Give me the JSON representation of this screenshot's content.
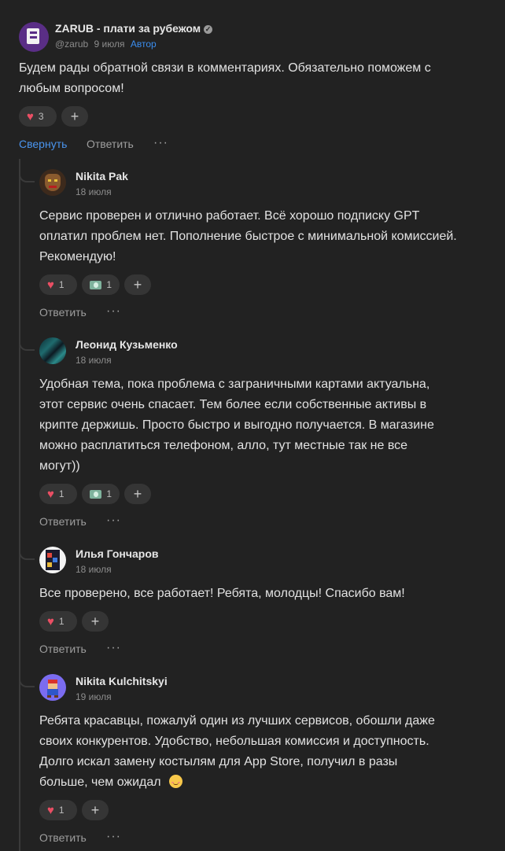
{
  "main_post": {
    "author": "ZARUB - плати за рубежом",
    "handle": "@zarub",
    "date": "9 июля",
    "tag": "Автор",
    "text": "Будем рады обратной связи в комментариях. Обязательно поможем с любым вопросом!",
    "likes": "3",
    "collapse_label": "Свернуть",
    "reply_label": "Ответить",
    "more_label": "···"
  },
  "comments": [
    {
      "author": "Nikita Pak",
      "date": "18 июля",
      "text": "Сервис проверен и отлично работает. Всё хорошо подписку GPT оплатил проблем нет. Пополнение быстрое с минимальной комиссией. Рекомендую!",
      "likes": "1",
      "money": "1",
      "reply_label": "Ответить",
      "more_label": "···"
    },
    {
      "author": "Леонид Кузьменко",
      "date": "18 июля",
      "text": "Удобная тема, пока проблема с заграничными картами актуальна, этот сервис очень спасает. Тем более если собственные активы в крипте держишь. Просто быстро и выгодно получается. В магазине можно расплатиться телефоном, алло, тут местные так не все могут))",
      "likes": "1",
      "money": "1",
      "reply_label": "Ответить",
      "more_label": "···"
    },
    {
      "author": "Илья Гончаров",
      "date": "18 июля",
      "text": "Все проверено, все работает! Ребята, молодцы! Спасибо вам!",
      "likes": "1",
      "reply_label": "Ответить",
      "more_label": "···"
    },
    {
      "author": "Nikita Kulchitskyi",
      "date": "19 июля",
      "text": "Ребята красавцы, пожалуй один из лучших сервисов, обошли даже своих конкурентов. Удобство, небольшая комиссия и доступность. Долго искал замену костылям для App Store, получил в разы больше, чем ожидал",
      "likes": "1",
      "reply_label": "Ответить",
      "more_label": "···"
    }
  ],
  "icons": {
    "heart": "heart-icon",
    "money": "money-icon",
    "plus": "plus-icon",
    "verified": "verified-icon",
    "emoji": "smiling-face-icon"
  },
  "colors": {
    "background": "#222222",
    "accent": "#4a94ee",
    "heart": "#ea4f64"
  }
}
